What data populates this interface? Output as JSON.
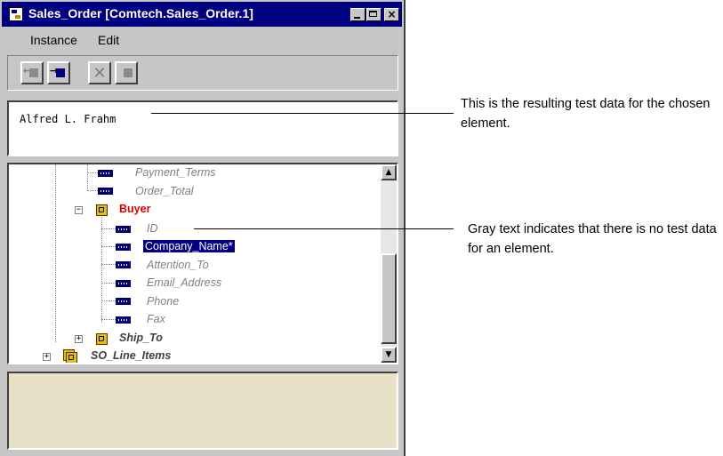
{
  "window": {
    "title": "Sales_Order [Comtech.Sales_Order.1]",
    "controls": [
      "minimize",
      "maximize",
      "close"
    ],
    "close_glyph": "×"
  },
  "menu": [
    "Instance",
    "Edit"
  ],
  "toolbar": {
    "buttons": [
      {
        "icon": "import-icon",
        "enabled": false
      },
      {
        "icon": "export-icon",
        "enabled": true
      },
      {
        "icon": "delete-icon",
        "enabled": false,
        "glyph": "✕"
      },
      {
        "icon": "copy-icon",
        "enabled": false
      }
    ]
  },
  "value": "Alfred L. Frahm",
  "tree": {
    "nodes": [
      {
        "label": "Payment_Terms",
        "type": "leaf",
        "has_data": false
      },
      {
        "label": "Order_Total",
        "type": "leaf",
        "has_data": false
      },
      {
        "label": "Buyer",
        "type": "group",
        "expanded": true,
        "state": "active",
        "expander": "−"
      },
      {
        "label": "ID",
        "type": "leaf",
        "has_data": false
      },
      {
        "label": "Company_Name*",
        "type": "leaf",
        "has_data": true,
        "selected": true
      },
      {
        "label": "Attention_To",
        "type": "leaf",
        "has_data": false
      },
      {
        "label": "Email_Address",
        "type": "leaf",
        "has_data": false
      },
      {
        "label": "Phone",
        "type": "leaf",
        "has_data": false
      },
      {
        "label": "Fax",
        "type": "leaf",
        "has_data": false
      },
      {
        "label": "Ship_To",
        "type": "group",
        "expanded": false,
        "expander": "+"
      },
      {
        "label": "SO_Line_Items",
        "type": "group-multi",
        "expanded": false,
        "expander": "+"
      }
    ],
    "scroll_up_glyph": "▲",
    "scroll_down_glyph": "▼"
  },
  "callouts": [
    {
      "text": "This is the resulting test data for the chosen element."
    },
    {
      "text": "Gray text indicates that there is no test data for an element."
    }
  ],
  "colors": {
    "title_bar": "#000080",
    "active_group": "#e00000",
    "no_data_text": "#808080",
    "selection": "#000080",
    "detail_panel": "#e9e0c8"
  }
}
